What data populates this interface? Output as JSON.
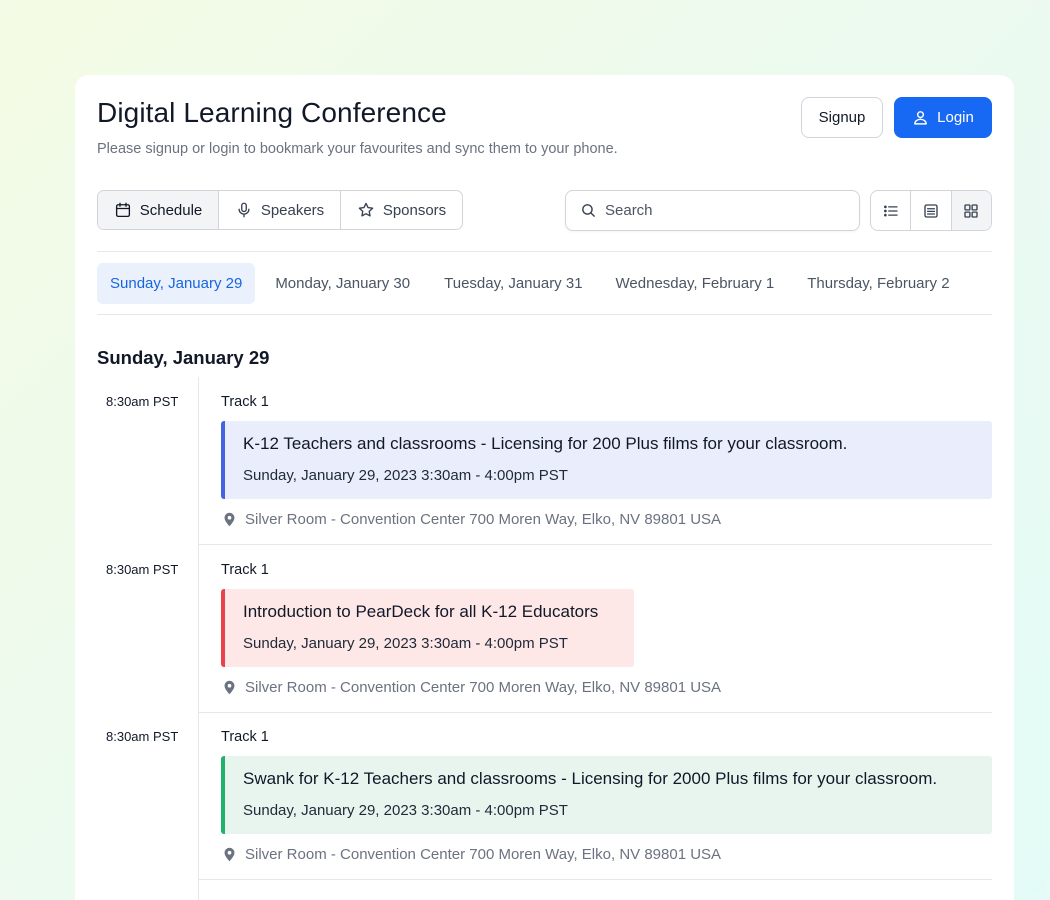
{
  "header": {
    "title": "Digital Learning Conference",
    "subtitle": "Please signup or login to bookmark your favourites and sync them to your phone.",
    "signup_label": "Signup",
    "login_label": "Login"
  },
  "tabs": [
    {
      "label": "Schedule",
      "icon": "calendar-icon",
      "active": true
    },
    {
      "label": "Speakers",
      "icon": "microphone-icon",
      "active": false
    },
    {
      "label": "Sponsors",
      "icon": "star-icon",
      "active": false
    }
  ],
  "search": {
    "placeholder": "Search",
    "value": ""
  },
  "view_modes": [
    {
      "icon": "list-view-icon",
      "active": false
    },
    {
      "icon": "compact-view-icon",
      "active": false
    },
    {
      "icon": "grid-view-icon",
      "active": true
    }
  ],
  "days": [
    {
      "label": "Sunday, January 29",
      "active": true
    },
    {
      "label": "Monday, January 30",
      "active": false
    },
    {
      "label": "Tuesday, January 31",
      "active": false
    },
    {
      "label": "Wednesday, February 1",
      "active": false
    },
    {
      "label": "Thursday, February 2",
      "active": false
    }
  ],
  "section_title": "Sunday, January 29",
  "sessions": [
    {
      "time": "8:30am PST",
      "track": "Track 1",
      "title": "K-12 Teachers and classrooms - Licensing for 200 Plus films for your classroom.",
      "datetime": "Sunday, January 29, 2023 3:30am - 4:00pm PST",
      "location": "Silver Room - Convention Center 700 Moren Way, Elko, NV 89801 USA",
      "bg_color": "#eaeefc",
      "accent_color": "#4563dd"
    },
    {
      "time": "8:30am PST",
      "track": "Track 1",
      "title": "Introduction to PearDeck for all K-12 Educators",
      "datetime": "Sunday, January 29, 2023 3:30am - 4:00pm PST",
      "location": "Silver Room - Convention Center 700 Moren Way, Elko, NV 89801 USA",
      "bg_color": "#fde7e7",
      "accent_color": "#e9424a"
    },
    {
      "time": "8:30am PST",
      "track": "Track 1",
      "title": "Swank for K-12 Teachers and classrooms - Licensing for 2000 Plus films for your classroom.",
      "datetime": "Sunday, January 29, 2023 3:30am - 4:00pm PST",
      "location": "Silver Room - Convention Center 700 Moren Way, Elko, NV 89801 USA",
      "bg_color": "#e8f5ef",
      "accent_color": "#21b06d"
    }
  ]
}
